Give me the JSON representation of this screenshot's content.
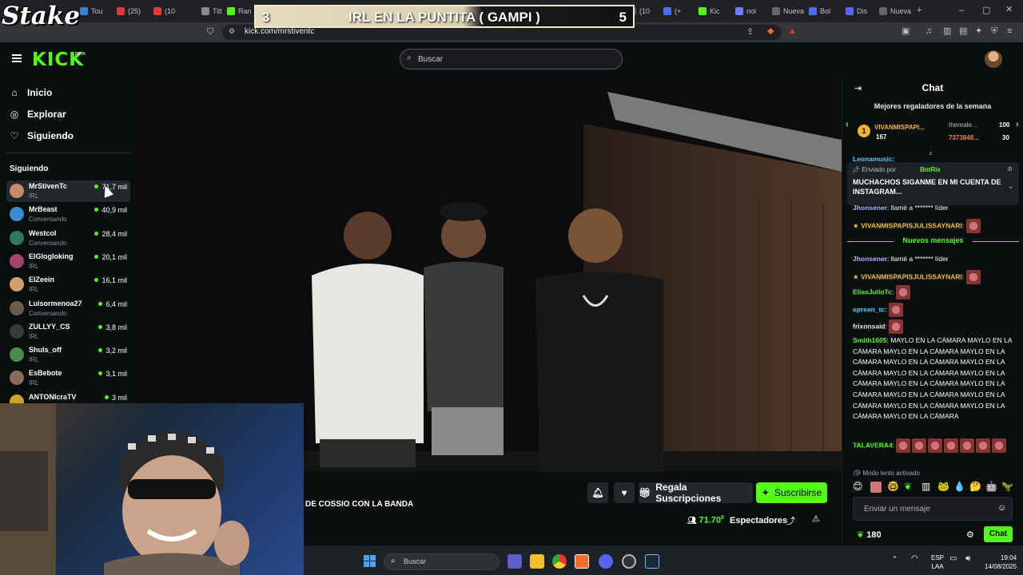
{
  "browser": {
    "tabs": [
      {
        "label": "Tou",
        "color": "#3f7fd0"
      },
      {
        "label": "(25)",
        "color": "#e23a3a"
      },
      {
        "label": "(10",
        "color": "#e23a3a"
      },
      {
        "label": "Tilt",
        "color": "#888888"
      },
      {
        "label": "Ran",
        "color": "#53fc18"
      },
      {
        "label": "pixi",
        "color": "#999999"
      },
      {
        "label": "Kic",
        "color": "#53fc18"
      },
      {
        "label": "(10",
        "color": "#555555"
      },
      {
        "label": "(+",
        "color": "#4a6cf0"
      },
      {
        "label": "Kic",
        "color": "#53fc18"
      },
      {
        "label": "noi",
        "color": "#6b7cff"
      },
      {
        "label": "Nueva",
        "color": "#666666"
      },
      {
        "label": "Bol",
        "color": "#4a6cf0"
      },
      {
        "label": "Dis",
        "color": "#5865f2"
      },
      {
        "label": "Nueva",
        "color": "#666666"
      }
    ],
    "url": "kick.com/mrstiventc"
  },
  "overlay": {
    "brand": "Stake",
    "banner_left": "3",
    "banner_title": "IRL EN LA PUNTITA ( GAMPI )",
    "banner_right": "5"
  },
  "header": {
    "logo": "KICK",
    "beta": "BETA",
    "search_placeholder": "Buscar"
  },
  "sidebar": {
    "nav": [
      {
        "label": "Inicio",
        "icon": "home-icon"
      },
      {
        "label": "Explorar",
        "icon": "compass-icon"
      },
      {
        "label": "Siguiendo",
        "icon": "heart-icon"
      }
    ],
    "section_title": "Siguiendo",
    "channels": [
      {
        "name": "MrStivenTc",
        "category": "IRL",
        "viewers": "71,7 mil",
        "avatar": "#c98a6a"
      },
      {
        "name": "MrBeast",
        "category": "Conversando",
        "viewers": "40,9 mil",
        "avatar": "#3a8ed0"
      },
      {
        "name": "Westcol",
        "category": "Conversando",
        "viewers": "28,4 mil",
        "avatar": "#2b7a5a"
      },
      {
        "name": "ElGlogloking",
        "category": "IRL",
        "viewers": "20,1 mil",
        "avatar": "#a0456a"
      },
      {
        "name": "ElZeein",
        "category": "IRL",
        "viewers": "16,1 mil",
        "avatar": "#d2a070"
      },
      {
        "name": "Luisormenoa27",
        "category": "Conversando",
        "viewers": "6,4 mil",
        "avatar": "#6a5a4a"
      },
      {
        "name": "ZULLYY_CS",
        "category": "IRL",
        "viewers": "3,8 mil",
        "avatar": "#3a3a3a"
      },
      {
        "name": "Shuls_off",
        "category": "IRL",
        "viewers": "3,2 mil",
        "avatar": "#4a8a4a"
      },
      {
        "name": "EsBebote",
        "category": "IRL",
        "viewers": "3,1 mil",
        "avatar": "#8a6a5a"
      },
      {
        "name": "ANTONIcraTV",
        "category": "",
        "viewers": "3 mil",
        "avatar": "#d0a020"
      }
    ]
  },
  "stream": {
    "title": "DE COSSIO CON LA BANDA",
    "gift_label": "Regala Suscripciones",
    "subscribe_label": "Suscribirse",
    "viewers": "71.70",
    "viewers_sup": "8",
    "viewers_label": "Espectadores"
  },
  "chat": {
    "title": "Chat",
    "gifters_title": "Mejores regaladores de la semana",
    "gifter1": {
      "rank": "1",
      "name": "VIVANMISPAPI...",
      "count": "167"
    },
    "gifter2": {
      "name": "thereale...",
      "count": "100"
    },
    "gifter3": {
      "name": "7373848...",
      "count": "30"
    },
    "partial_user": "Leonamusic:",
    "pinned": {
      "sent_by": "Enviado por",
      "bot": "BotRix",
      "text": "MUCHACHOS SIGANME EN MI CUENTA DE INSTAGRAM..."
    },
    "new_messages": "Nuevos mensajes",
    "messages": [
      {
        "user": "Jhonsener",
        "color": "#a8b8ff",
        "text": "llamé a ******* líder"
      },
      {
        "user": "VIVANMISPAPISJULISSAYNARI",
        "color": "#f0c040",
        "text": ""
      },
      {
        "user": "Jhonsener",
        "color": "#a8b8ff",
        "text": "llamé a ******* líder"
      },
      {
        "user": "VIVANMISPAPISJULISSAYNARI",
        "color": "#f0c040",
        "text": ""
      },
      {
        "user": "EliasJulioTc",
        "color": "#53fc18",
        "text": ""
      },
      {
        "user": "spreen_tc",
        "color": "#53d0fc",
        "text": ""
      },
      {
        "user": "frixonsaid",
        "color": "#e8e8e8",
        "text": ""
      },
      {
        "user": "Smith1605",
        "color": "#53fc18",
        "text": "MAYLO EN LA CÁMARA MAYLO EN LA CÁMARA MAYLO EN LA CÁMARA MAYLO EN LA CÁMARA MAYLO EN LA CÁMARA MAYLO EN LA CÁMARA MAYLO EN LA CÁMARA MAYLO EN LA CÁMARA MAYLO EN LA CÁMARA MAYLO EN LA CÁMARA MAYLO EN LA CÁMARA MAYLO EN LA CÁMARA MAYLO EN LA CÁMARA MAYLO EN LA CÁMARA MAYLO EN LA CÁMARA"
      },
      {
        "user": "TALAVERA4",
        "color": "#53fc18",
        "text": ""
      }
    ],
    "slow_mode": "Modo lento activado",
    "input_placeholder": "Enviar un mensaje",
    "points": "180",
    "chat_button": "Chat"
  },
  "taskbar": {
    "search_placeholder": "Buscar",
    "lang": "ESP",
    "lang2": "LAA",
    "time": "19:04",
    "date": "14/08/2025"
  }
}
